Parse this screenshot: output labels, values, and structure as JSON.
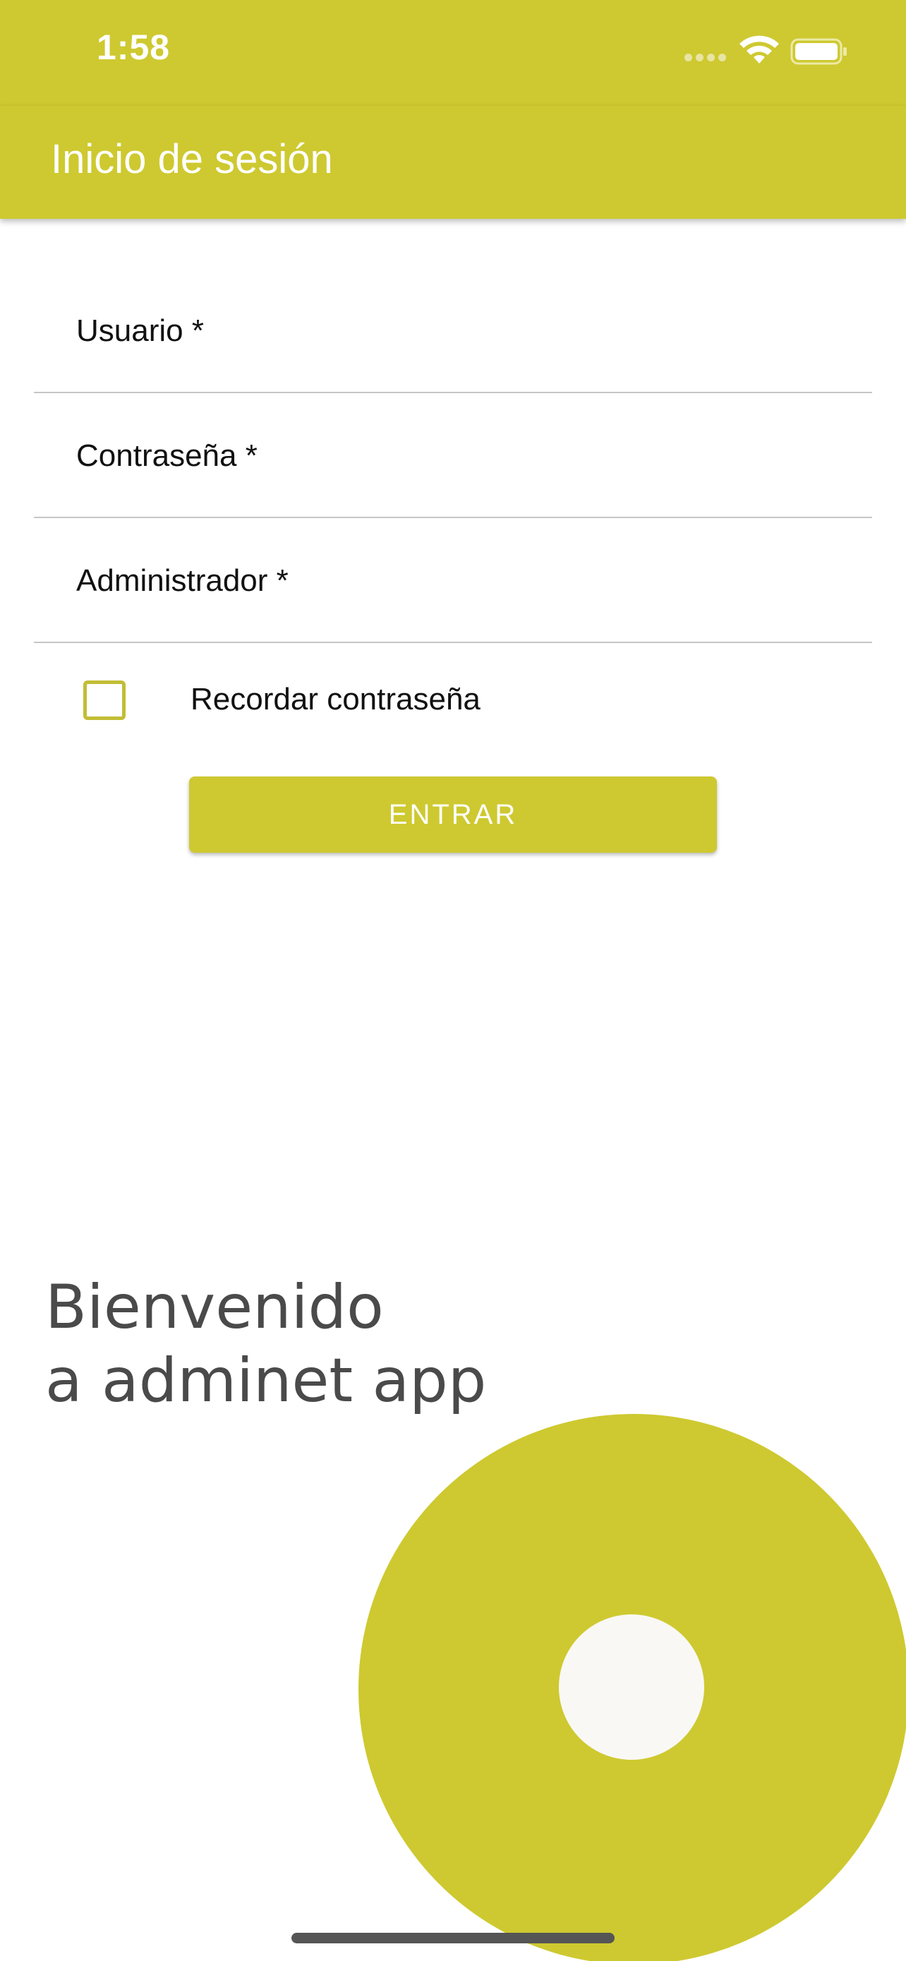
{
  "status_bar": {
    "time": "1:58",
    "signal_icon": "cellular-signal-icon",
    "wifi_icon": "wifi-icon",
    "battery_icon": "battery-icon"
  },
  "app_bar": {
    "title": "Inicio de sesión"
  },
  "form": {
    "username": {
      "label": "Usuario *",
      "value": ""
    },
    "password": {
      "label": "Contraseña *",
      "value": ""
    },
    "admin": {
      "label": "Administrador *",
      "value": ""
    },
    "remember": {
      "label": "Recordar contraseña",
      "checked": false
    },
    "submit_label": "ENTRAR"
  },
  "welcome": {
    "line1": "Bienvenido",
    "line2": "a adminet app"
  },
  "colors": {
    "accent": "#cec930",
    "text_dark": "#4a4a4a",
    "inner_circle": "#f9f8f5"
  }
}
